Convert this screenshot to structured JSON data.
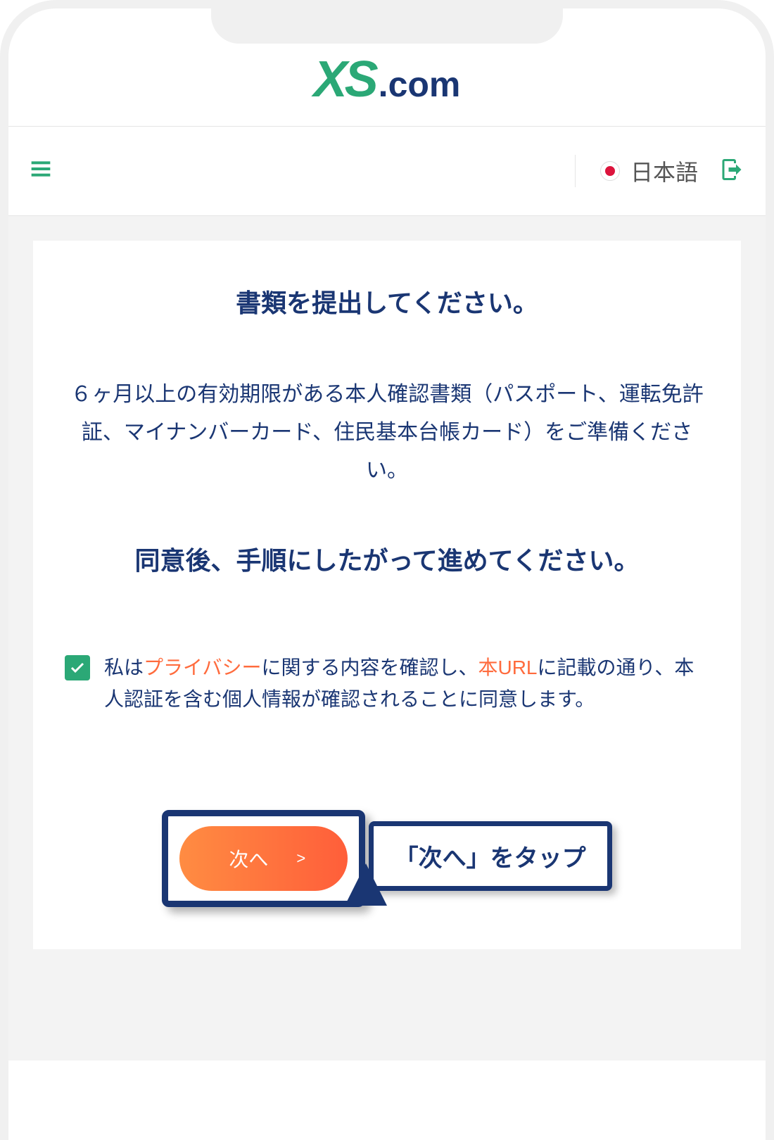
{
  "logo": {
    "xs": "XS",
    "com": ".com"
  },
  "header": {
    "language_label": "日本語"
  },
  "main": {
    "title": "書類を提出してください。",
    "description": "６ヶ月以上の有効期限がある本人確認書類（パスポート、運転免許証、マイナンバーカード、住民基本台帳カード）をご準備ください。",
    "subtitle": "同意後、手順にしたがって進めてください。"
  },
  "consent": {
    "checked": true,
    "text_prefix": "私は",
    "link_privacy": "プライバシー",
    "text_mid": "に関する内容を確認し、",
    "link_url": "本URL",
    "text_suffix": "に記載の通り、本人認証を含む個人情報が確認されることに同意します。"
  },
  "button": {
    "next_label": "次へ",
    "chevron": ">"
  },
  "annotation": {
    "label": "「次へ」をタップ"
  }
}
